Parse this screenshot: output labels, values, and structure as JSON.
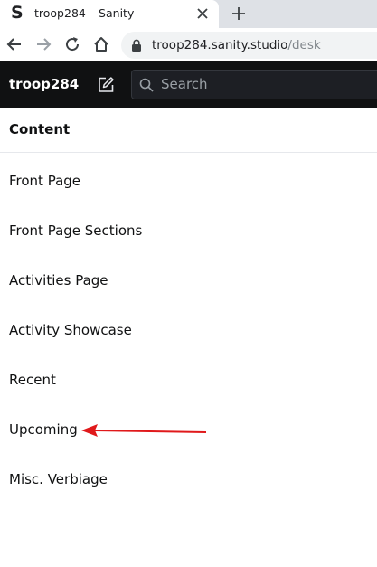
{
  "browser": {
    "tab_favicon": "S",
    "tab_title": "troop284 – Sanity",
    "url_host": "troop284.sanity.studio",
    "url_path": "/desk"
  },
  "navbar": {
    "brand": "troop284",
    "search_placeholder": "Search"
  },
  "pane": {
    "title": "Content",
    "items": [
      {
        "label": "Front Page"
      },
      {
        "label": "Front Page Sections"
      },
      {
        "label": "Activities Page"
      },
      {
        "label": "Activity Showcase"
      },
      {
        "label": "Recent"
      },
      {
        "label": "Upcoming"
      },
      {
        "label": "Misc. Verbiage"
      }
    ]
  },
  "annotation": {
    "arrow_color": "#e0191b",
    "points_to": "Upcoming"
  }
}
